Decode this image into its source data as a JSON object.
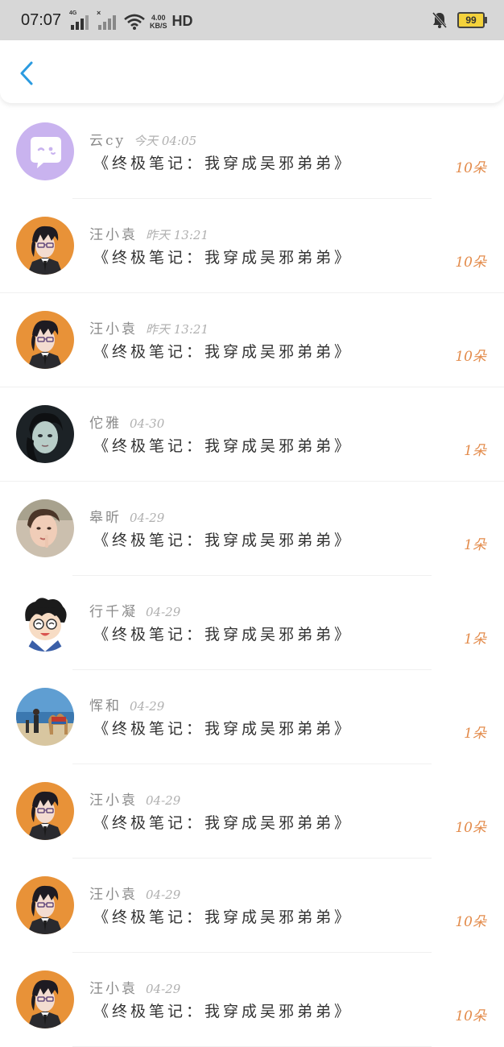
{
  "status_bar": {
    "time": "07:07",
    "network_label": "4G",
    "speed_value": "4.00",
    "speed_unit": "KB/S",
    "hd_label": "HD",
    "battery": "99"
  },
  "colors": {
    "accent_back": "#2b9be0",
    "count": "#e38b4b"
  },
  "rows": [
    {
      "name": "云cy",
      "time": "今天 04:05",
      "book": "《终极笔记：我穿成吴邪弟弟》",
      "count": "10朵",
      "avatar": "chat-bubble-avatar"
    },
    {
      "name": "汪小袁",
      "time": "昨天 13:21",
      "book": "《终极笔记：我穿成吴邪弟弟》",
      "count": "10朵",
      "avatar": "anime-man-avatar"
    },
    {
      "name": "汪小袁",
      "time": "昨天 13:21",
      "book": "《终极笔记：我穿成吴邪弟弟》",
      "count": "10朵",
      "avatar": "anime-man-avatar"
    },
    {
      "name": "佗雅",
      "time": "04-30",
      "book": "《终极笔记：我穿成吴邪弟弟》",
      "count": "1朵",
      "avatar": "dark-portrait-avatar"
    },
    {
      "name": "皋昕",
      "time": "04-29",
      "book": "《终极笔记：我穿成吴邪弟弟》",
      "count": "1朵",
      "avatar": "girl-photo-avatar"
    },
    {
      "name": "行千凝",
      "time": "04-29",
      "book": "《终极笔记：我穿成吴邪弟弟》",
      "count": "1朵",
      "avatar": "cartoon-boy-avatar"
    },
    {
      "name": "恽和",
      "time": "04-29",
      "book": "《终极笔记：我穿成吴邪弟弟》",
      "count": "1朵",
      "avatar": "beach-camel-avatar"
    },
    {
      "name": "汪小袁",
      "time": "04-29",
      "book": "《终极笔记：我穿成吴邪弟弟》",
      "count": "10朵",
      "avatar": "anime-man-avatar"
    },
    {
      "name": "汪小袁",
      "time": "04-29",
      "book": "《终极笔记：我穿成吴邪弟弟》",
      "count": "10朵",
      "avatar": "anime-man-avatar"
    },
    {
      "name": "汪小袁",
      "time": "04-29",
      "book": "《终极笔记：我穿成吴邪弟弟》",
      "count": "10朵",
      "avatar": "anime-man-avatar"
    }
  ]
}
